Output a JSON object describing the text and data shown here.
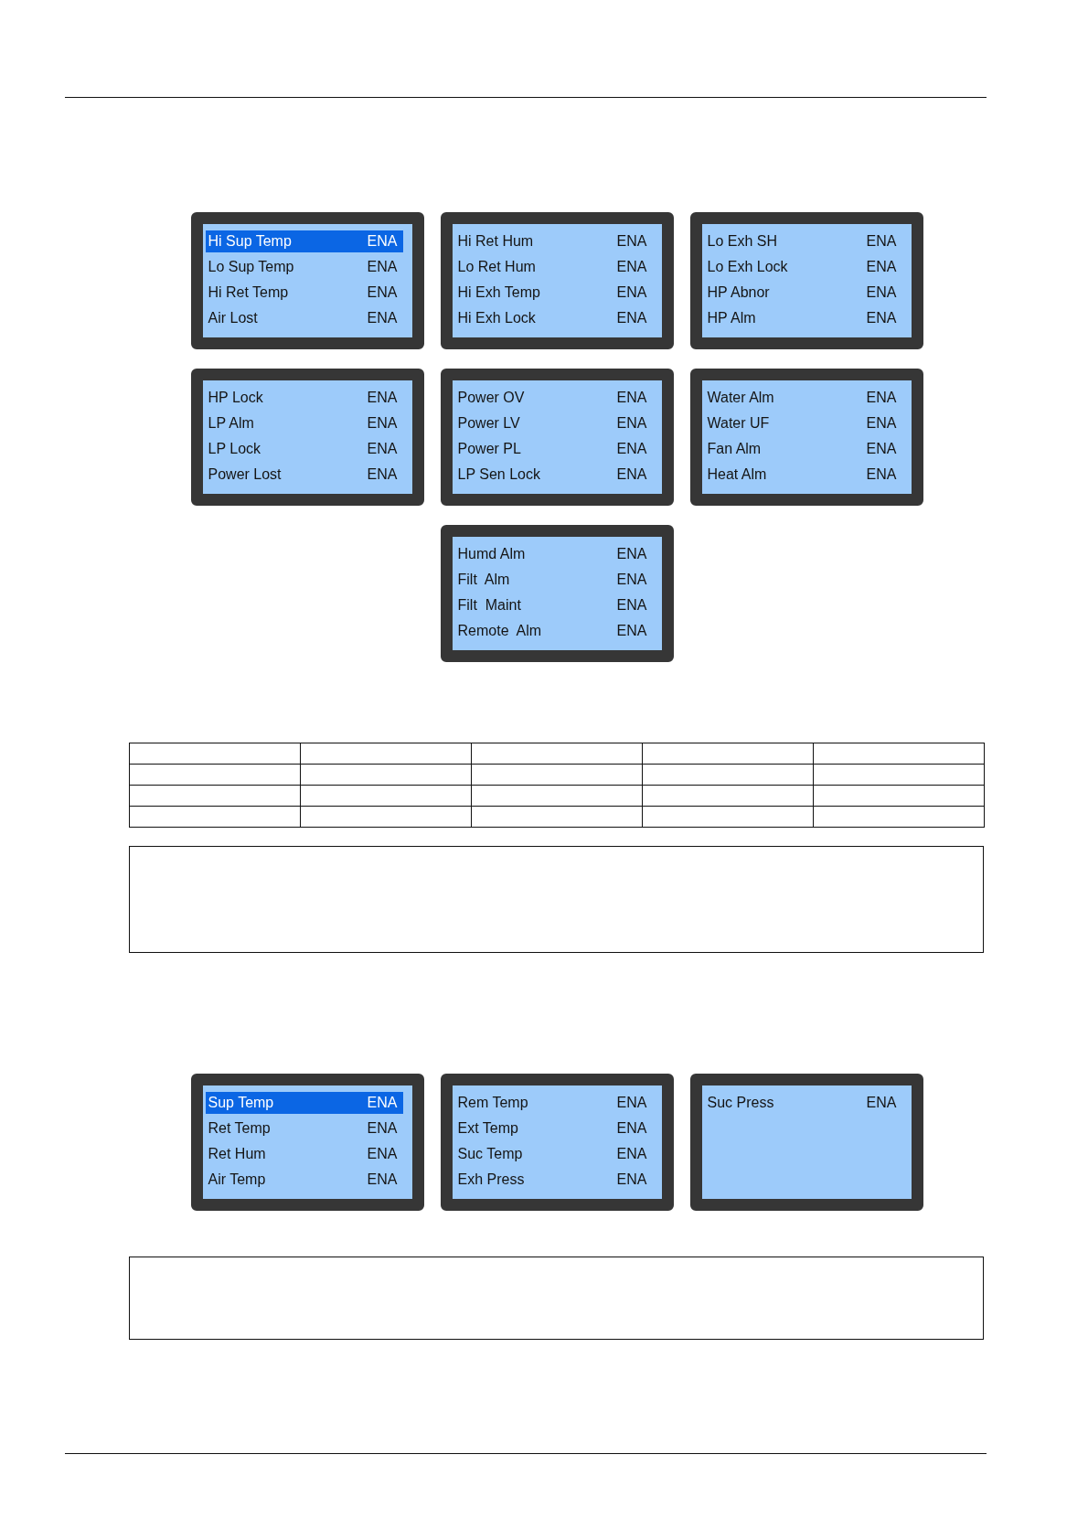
{
  "figures": [
    {
      "screens": [
        {
          "rows": [
            {
              "label": "Hi Sup Temp",
              "value": "ENA",
              "selected": true
            },
            {
              "label": "Lo Sup Temp",
              "value": "ENA",
              "selected": false
            },
            {
              "label": "Hi Ret Temp",
              "value": "ENA",
              "selected": false
            },
            {
              "label": "Air Lost",
              "value": "ENA",
              "selected": false
            }
          ]
        },
        {
          "rows": [
            {
              "label": "Hi Ret Hum",
              "value": "ENA",
              "selected": false
            },
            {
              "label": "Lo Ret Hum",
              "value": "ENA",
              "selected": false
            },
            {
              "label": "Hi Exh Temp",
              "value": "ENA",
              "selected": false
            },
            {
              "label": "Hi Exh Lock",
              "value": "ENA",
              "selected": false
            }
          ]
        },
        {
          "rows": [
            {
              "label": "Lo Exh SH",
              "value": "ENA",
              "selected": false
            },
            {
              "label": "Lo Exh Lock",
              "value": "ENA",
              "selected": false
            },
            {
              "label": "HP Abnor",
              "value": "ENA",
              "selected": false
            },
            {
              "label": "HP Alm",
              "value": "ENA",
              "selected": false
            }
          ]
        },
        {
          "rows": [
            {
              "label": "HP Lock",
              "value": "ENA",
              "selected": false
            },
            {
              "label": "LP Alm",
              "value": "ENA",
              "selected": false
            },
            {
              "label": "LP Lock",
              "value": "ENA",
              "selected": false
            },
            {
              "label": "Power Lost",
              "value": "ENA",
              "selected": false
            }
          ]
        },
        {
          "rows": [
            {
              "label": "Power OV",
              "value": "ENA",
              "selected": false
            },
            {
              "label": "Power LV",
              "value": "ENA",
              "selected": false
            },
            {
              "label": "Power PL",
              "value": "ENA",
              "selected": false
            },
            {
              "label": "LP Sen Lock",
              "value": "ENA",
              "selected": false
            }
          ]
        },
        {
          "rows": [
            {
              "label": "Water Alm",
              "value": "ENA",
              "selected": false
            },
            {
              "label": "Water UF",
              "value": "ENA",
              "selected": false
            },
            {
              "label": "Fan Alm",
              "value": "ENA",
              "selected": false
            },
            {
              "label": "Heat Alm",
              "value": "ENA",
              "selected": false
            }
          ]
        },
        {
          "rows": [
            {
              "label": "Humd Alm",
              "value": "ENA",
              "selected": false
            },
            {
              "label": "Filt  Alm",
              "value": "ENA",
              "selected": false
            },
            {
              "label": "Filt  Maint",
              "value": "ENA",
              "selected": false
            },
            {
              "label": "Remote  Alm",
              "value": "ENA",
              "selected": false
            }
          ]
        }
      ]
    },
    {
      "screens": [
        {
          "rows": [
            {
              "label": "Sup Temp",
              "value": "ENA",
              "selected": true
            },
            {
              "label": "Ret Temp",
              "value": "ENA",
              "selected": false
            },
            {
              "label": "Ret Hum",
              "value": "ENA",
              "selected": false
            },
            {
              "label": "Air Temp",
              "value": "ENA",
              "selected": false
            }
          ]
        },
        {
          "rows": [
            {
              "label": "Rem Temp",
              "value": "ENA",
              "selected": false
            },
            {
              "label": "Ext Temp",
              "value": "ENA",
              "selected": false
            },
            {
              "label": "Suc Temp",
              "value": "ENA",
              "selected": false
            },
            {
              "label": "Exh Press",
              "value": "ENA",
              "selected": false
            }
          ]
        },
        {
          "rows": [
            {
              "label": "Suc Press",
              "value": "ENA",
              "selected": false
            }
          ]
        }
      ]
    }
  ]
}
